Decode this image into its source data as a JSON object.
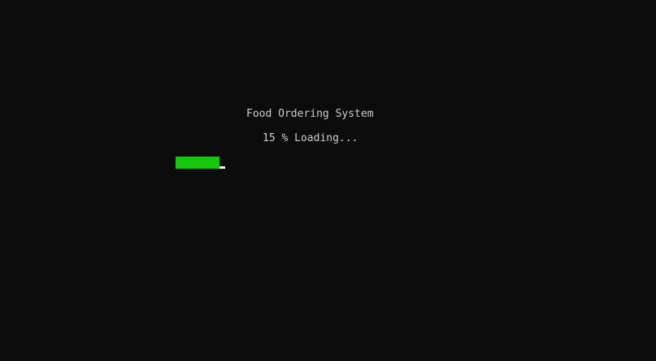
{
  "console": {
    "title": "Food Ordering System",
    "status_text": "15 % Loading...",
    "progress_fraction": 0.15
  },
  "colors": {
    "background": "#0c0c0c",
    "text": "#cccccc",
    "progress": "#16c60c",
    "cursor": "#f2f2f2"
  }
}
